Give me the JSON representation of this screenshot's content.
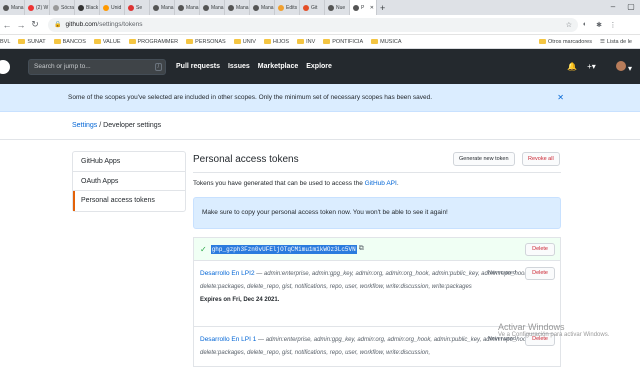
{
  "browser": {
    "tabs": [
      {
        "label": "Mana"
      },
      {
        "label": "(2) W"
      },
      {
        "label": "Sócra"
      },
      {
        "label": "Black"
      },
      {
        "label": "Unid"
      },
      {
        "label": "Se"
      },
      {
        "label": "Mana"
      },
      {
        "label": "Mana"
      },
      {
        "label": "Mana"
      },
      {
        "label": "Mana"
      },
      {
        "label": "Mana"
      },
      {
        "label": "Edits"
      },
      {
        "label": "Git"
      },
      {
        "label": "Nue"
      },
      {
        "label": "P",
        "active": true
      }
    ],
    "new_tab": "+",
    "url_host": "github.com",
    "url_path": "/settings/tokens",
    "bookmarks": [
      "BVL",
      "SUNAT",
      "BANCOS",
      "VALUE",
      "PROGRAMMER",
      "PERSONAS",
      "UNIV",
      "HIJOS",
      "INV",
      "PONTIFICIA",
      "MUSICA"
    ],
    "other_bookmarks": "Otros marcadores",
    "reading_list": "Lista de le"
  },
  "github": {
    "search_placeholder": "Search or jump to...",
    "search_shortcut": "/",
    "nav": [
      "Pull requests",
      "Issues",
      "Marketplace",
      "Explore"
    ],
    "plus": "+▾"
  },
  "flash": {
    "message": "Some of the scopes you've selected are included in other scopes. Only the minimum set of necessary scopes has been saved."
  },
  "breadcrumb": {
    "settings": "Settings",
    "separator": "/",
    "current": "Developer settings"
  },
  "sidebar": {
    "items": [
      {
        "label": "GitHub Apps"
      },
      {
        "label": "OAuth Apps"
      },
      {
        "label": "Personal access tokens"
      }
    ]
  },
  "main": {
    "title": "Personal access tokens",
    "generate_button": "Generate new token",
    "revoke_button": "Revoke all",
    "description_prefix": "Tokens you have generated that can be used to access the ",
    "description_link": "GitHub API",
    "description_suffix": ".",
    "copy_note": "Make sure to copy your personal access token now. You won't be able to see it again!",
    "new_token_value": "ghp_gzph3Fzn0vUFEljOTqCMimu1m1kWOz3Lc5VN",
    "delete_label": "Delete",
    "tokens": [
      {
        "name": "Desarrollo En LPI2",
        "scopes": "admin:enterprise, admin:gpg_key, admin:org, admin:org_hook, admin:public_key, admin:repo_hook, delete:packages, delete_repo, gist, notifications, repo, user, workflow, write:discussion, write:packages",
        "expires": "Expires on Fri, Dec 24 2021.",
        "used": "Never used"
      },
      {
        "name": "Desarrollo En LPI 1",
        "scopes": "admin:enterprise, admin:gpg_key, admin:org, admin:org_hook, admin:public_key, admin:repo_hook, delete:packages, delete_repo, gist, notifications, repo, user, workflow, write:discussion,",
        "used": "Never used"
      }
    ]
  },
  "watermark": {
    "line1": "Activar Windows",
    "line2": "Ve a Configuración para activar Windows."
  }
}
